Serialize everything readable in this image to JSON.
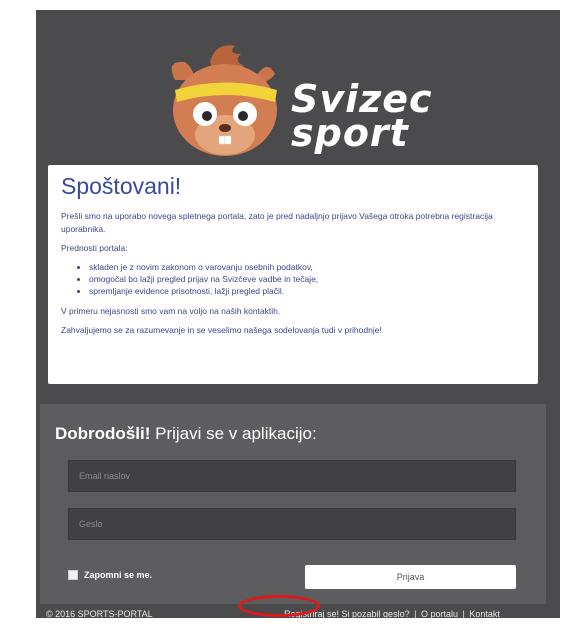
{
  "brand": {
    "line1": "Svizec",
    "line2": "sport",
    "mascot_icon": "squirrel-mascot-icon"
  },
  "notice": {
    "title": "Spoštovani!",
    "intro": "Prešli smo na uporabo novega spletnega portala, zato je pred nadaljnjo prijavo Vašega otroka potrebna registracija uporabnika.",
    "advantages_heading": "Prednosti portala:",
    "advantages": [
      "skladen je z novim zakonom o varovanju osebnih podatkov,",
      "omogočal bo lažji pregled prijav na Svizčeve vadbe in tečaje,",
      "spremljanje evidence prisotnosti, lažji pregled plačil."
    ],
    "contact_text": "V primeru nejasnosti smo vam na voljo na naših kontaktih.",
    "thanks_text": "Zahvaljujemo se za razumevanje in se veselimo našega sodelovanja tudi v prihodnje!"
  },
  "login": {
    "welcome_bold": "Dobrodošli!",
    "welcome_rest": " Prijavi se v aplikacijo:",
    "email_placeholder": "Email naslov",
    "password_placeholder": "Geslo",
    "remember_label": "Zapomni se me.",
    "submit_label": "Prijava"
  },
  "footer": {
    "copyright": "© 2016 SPORTS-PORTAL",
    "register": "Registriraj se!",
    "forgot": "Si pozabil geslo?",
    "about": "O portalu",
    "contact": "Kontakt",
    "separator": "|"
  },
  "colors": {
    "page_bg": "#4b4b4d",
    "card_text": "#3b4690",
    "highlight": "#e01818"
  }
}
